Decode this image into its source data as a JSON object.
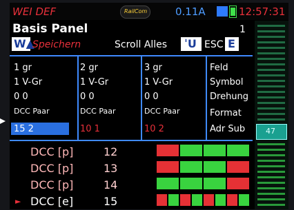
{
  "status_bar": {
    "device_name": "WEI DEF",
    "railcom_logo": "RailCom",
    "current": "0.11A",
    "time": "12:57:31",
    "icons": [
      "track-icon",
      "battery-icon"
    ]
  },
  "header": {
    "title": "Basis Panel",
    "page_number": "1"
  },
  "menu": {
    "wa_key": "W▲",
    "save_label": "Speichern",
    "scroll_label": "Scroll Alles",
    "up_key": "ˈU",
    "esc_label": "ESC",
    "enter_key": "E"
  },
  "columns": [
    {
      "row1": "1   gr",
      "row2": "1   V-Gr",
      "row3": "0   0",
      "row4": "DCC  Paar",
      "row5": "15   2"
    },
    {
      "row1": "2   gr",
      "row2": "1   V-Gr",
      "row3": "0   0",
      "row4": "DCC  Paar",
      "row5": "10   1"
    },
    {
      "row1": "3   gr",
      "row2": "1   V-Gr",
      "row3": "0   0",
      "row4": "DCC  Paar",
      "row5": "10   2"
    }
  ],
  "labels": [
    "Feld",
    "Symbol",
    "Drehung",
    "Format",
    "Adr Sub"
  ],
  "list": [
    {
      "addr": "DCC [p]",
      "num": "12"
    },
    {
      "addr": "DCC [p]",
      "num": "13"
    },
    {
      "addr": "DCC [p]",
      "num": "14"
    },
    {
      "marker": "►",
      "addr": "DCC [e]",
      "num": "15"
    }
  ],
  "status_grid": {
    "rows": [
      [
        "red",
        "green",
        "green",
        "green"
      ],
      [
        "red",
        "green",
        "green",
        "red"
      ],
      [
        "green",
        "green",
        "green",
        "red"
      ],
      [
        "red",
        "green",
        "red",
        "green",
        "red",
        "green",
        "red",
        "green"
      ]
    ],
    "colors": {
      "red": "#e53135",
      "green": "#39d33f"
    }
  },
  "slider": {
    "value": "47"
  },
  "colors": {
    "accent_blue": "#3f8aff",
    "alert_red": "#e8303a",
    "selection": "#2a6fe0"
  }
}
